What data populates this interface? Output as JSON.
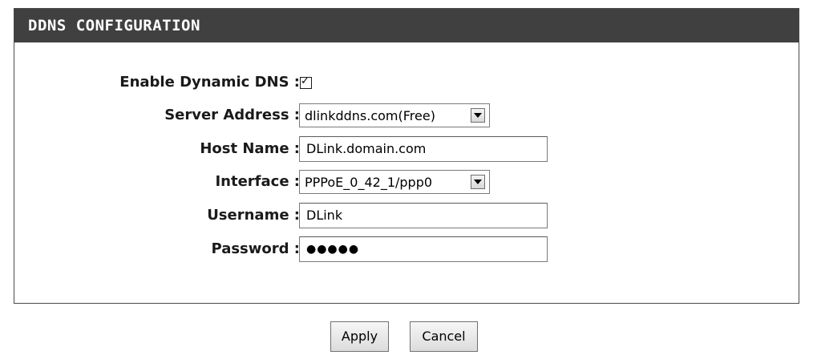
{
  "section": {
    "title": "DDNS CONFIGURATION"
  },
  "form": {
    "enable_ddns": {
      "label": "Enable Dynamic DNS :",
      "checked": true,
      "check_glyph": "✓"
    },
    "server_address": {
      "label": "Server Address :",
      "value": "dlinkddns.com(Free)"
    },
    "host_name": {
      "label": "Host Name :",
      "value": "DLink.domain.com"
    },
    "interface": {
      "label": "Interface :",
      "value": "PPPoE_0_42_1/ppp0"
    },
    "username": {
      "label": "Username :",
      "value": "DLink"
    },
    "password": {
      "label": "Password :",
      "value": "●●●●●"
    }
  },
  "actions": {
    "apply_label": "Apply",
    "cancel_label": "Cancel"
  }
}
